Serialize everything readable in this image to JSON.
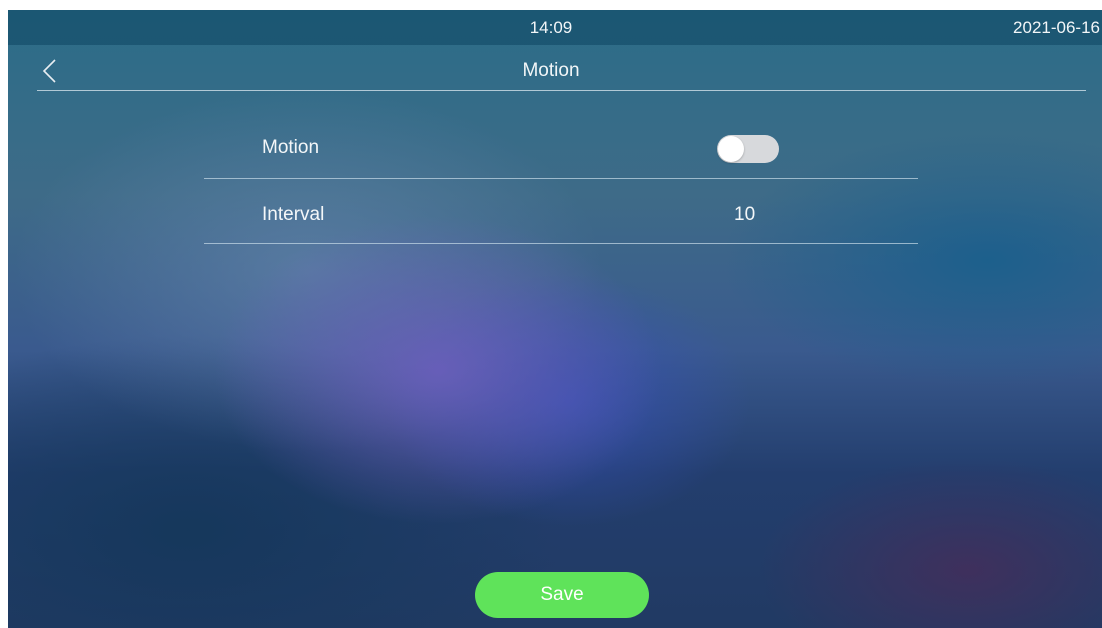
{
  "status_bar": {
    "time": "14:09",
    "date": "2021-06-16"
  },
  "header": {
    "back_icon": "chevron-left-icon",
    "title": "Motion"
  },
  "settings": {
    "motion": {
      "label": "Motion",
      "enabled": false
    },
    "interval": {
      "label": "Interval",
      "value": "10"
    }
  },
  "actions": {
    "save_label": "Save"
  },
  "colors": {
    "accent": "#5fe35a",
    "toggle_off": "#d7d9dc"
  }
}
